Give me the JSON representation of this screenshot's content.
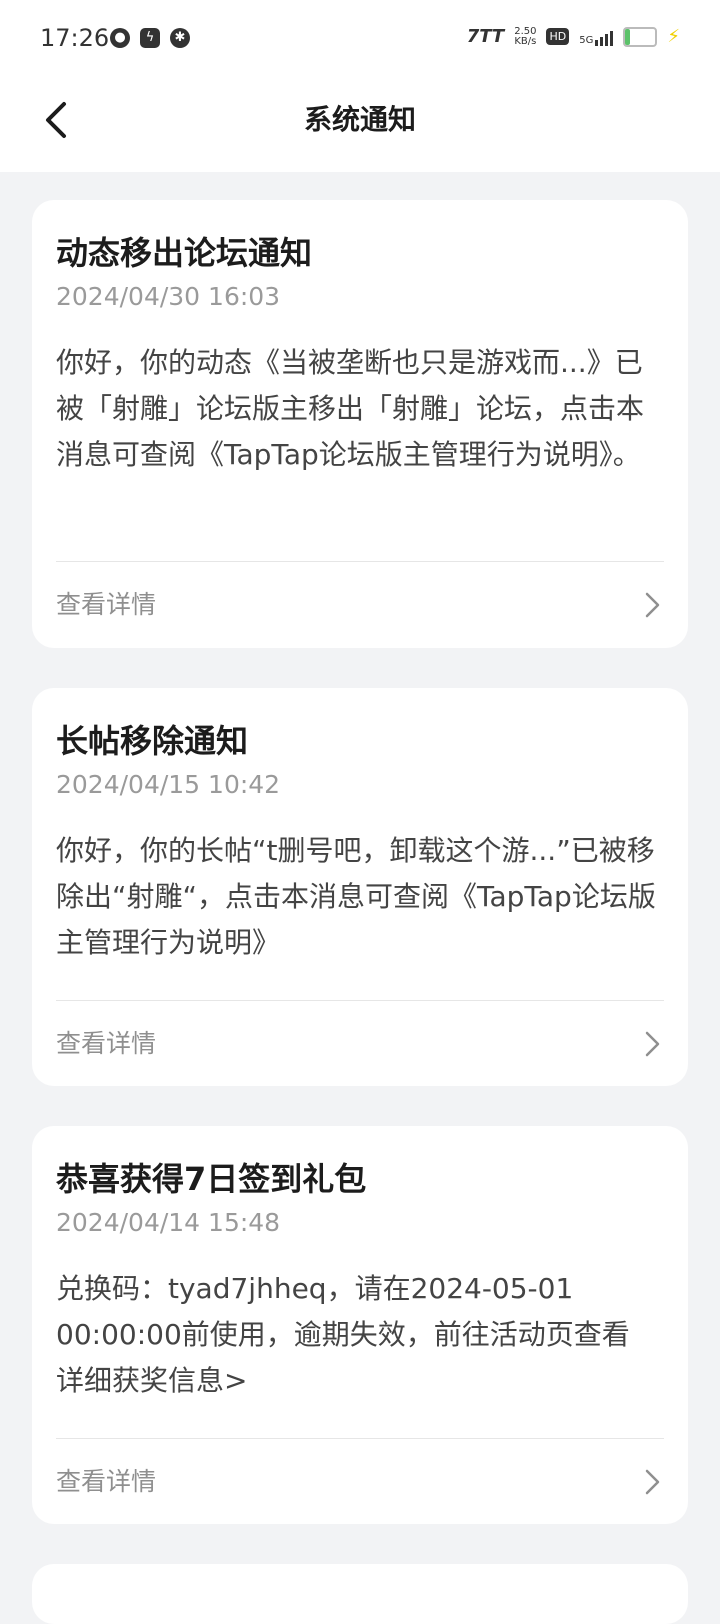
{
  "status_bar": {
    "time": "17:26",
    "net_speed_value": "2.50",
    "net_speed_unit": "KB/s",
    "hd": "HD",
    "signal": "5G",
    "battery_level": "14",
    "left_icons": [
      "cat-icon",
      "flash-icon",
      "gear-icon"
    ],
    "right_logo": "7TT"
  },
  "header": {
    "title": "系统通知"
  },
  "notifications": [
    {
      "title": "动态移出论坛通知",
      "time": "2024/04/30 16:03",
      "body": "你好，你的动态《当被垄断也只是游戏而...》已被「射雕」论坛版主移出「射雕」论坛，点击本消息可查阅《TapTap论坛版主管理行为说明》。",
      "link_label": "查看详情"
    },
    {
      "title": "长帖移除通知",
      "time": "2024/04/15 10:42",
      "body": "你好，你的长帖“t删号吧，卸载这个游...”已被移除出“射雕“，点击本消息可查阅《TapTap论坛版主管理行为说明》",
      "link_label": "查看详情"
    },
    {
      "title": "恭喜获得7日签到礼包",
      "time": "2024/04/14 15:48",
      "body": "兑换码：tyad7jhheq，请在2024-05-01 00:00:00前使用，逾期失效，前往活动页查看详细获奖信息>",
      "link_label": "查看详情"
    }
  ],
  "colors": {
    "background": "#f2f3f5",
    "card": "#ffffff",
    "title_text": "#1c1c1c",
    "secondary_text": "#9a9a9a"
  }
}
